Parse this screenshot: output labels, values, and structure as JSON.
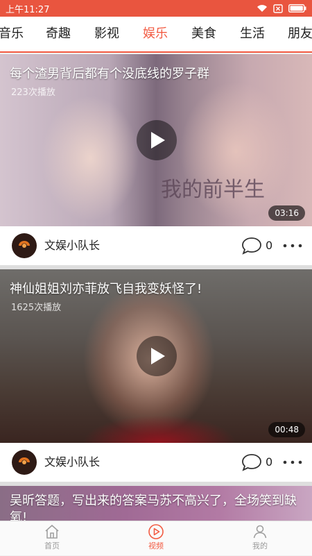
{
  "status_bar": {
    "time": "上午11:27"
  },
  "tabs": [
    {
      "label": "音乐"
    },
    {
      "label": "奇趣"
    },
    {
      "label": "影视"
    },
    {
      "label": "娱乐"
    },
    {
      "label": "美食"
    },
    {
      "label": "生活"
    },
    {
      "label": "朋友"
    }
  ],
  "active_tab": "娱乐",
  "videos": [
    {
      "title": "每个渣男背后都有个没底线的罗子群",
      "play_count": "223次播放",
      "duration": "03:16",
      "author": "文娱小队长",
      "comments": "0",
      "overlay_text": "我的前半生"
    },
    {
      "title": "神仙姐姐刘亦菲放飞自我变妖怪了!",
      "play_count": "1625次播放",
      "duration": "00:48",
      "author": "文娱小队长",
      "comments": "0"
    },
    {
      "title": "吴昕答题，写出来的答案马苏不高兴了，全场笑到缺氧!"
    }
  ],
  "bottom_nav": {
    "home": "首页",
    "video": "视频",
    "mine": "我的"
  },
  "colors": {
    "accent": "#f25a41",
    "status_bar": "#e9553f"
  }
}
